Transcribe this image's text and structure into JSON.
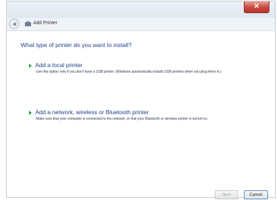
{
  "window": {
    "title": "Add Printer",
    "close_symbol": "✕"
  },
  "content": {
    "heading": "What type of printer do you want to install?",
    "options": [
      {
        "title": "Add a local printer",
        "description": "Use this option only if you don't have a USB printer. (Windows automatically installs USB printers when you plug them in.)"
      },
      {
        "title": "Add a network, wireless or Bluetooth printer",
        "description": "Make sure that your computer is connected to the network, or that your Bluetooth or wireless printer is turned on."
      }
    ]
  },
  "footer": {
    "next_label": "Next",
    "cancel_label": "Cancel"
  },
  "colors": {
    "heading": "#1e3f8a",
    "option_arrow": "#1aa23c",
    "close_button": "#c8453a"
  }
}
